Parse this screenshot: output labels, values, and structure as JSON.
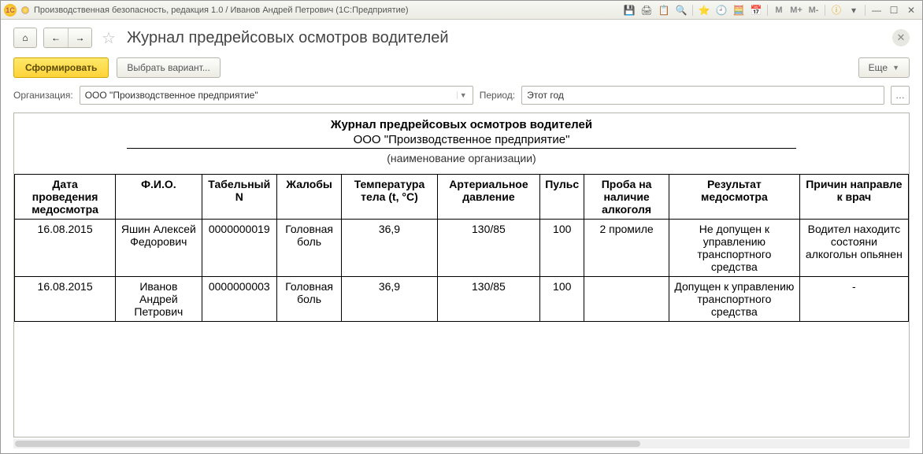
{
  "window": {
    "title": "Производственная безопасность, редакция 1.0 / Иванов Андрей Петрович  (1С:Предприятие)",
    "logo_text": "1C"
  },
  "titlebar_icons": {
    "save": "💾",
    "print": "🖨",
    "copy": "📋",
    "search": "🔍",
    "fav": "⭐",
    "history": "🕘",
    "calc": "🧮",
    "cal": "📅",
    "m": "M",
    "mplus": "M+",
    "mminus": "M-",
    "info": "ⓘ"
  },
  "win_controls": {
    "min": "—",
    "max": "☐",
    "close": "✕"
  },
  "page": {
    "title": "Журнал предрейсовых осмотров водителей"
  },
  "toolbar": {
    "form_btn": "Сформировать",
    "variant_btn": "Выбрать вариант...",
    "more_btn": "Еще"
  },
  "filters": {
    "org_label": "Организация:",
    "org_value": "ООО \"Производственное предприятие\"",
    "period_label": "Период:",
    "period_value": "Этот год"
  },
  "report_header": {
    "title": "Журнал предрейсовых осмотров водителей",
    "org": "ООО \"Производственное предприятие\"",
    "hint": "(наименование организации)"
  },
  "table": {
    "headers": [
      "Дата проведения медосмотра",
      "Ф.И.О.",
      "Табельный N",
      "Жалобы",
      "Температура тела (t, °C)",
      "Артериальное давление",
      "Пульс",
      "Проба на наличие алкоголя",
      "Результат медосмотра",
      "Причин направле к врач"
    ],
    "rows": [
      {
        "date": "16.08.2015",
        "fio": "Яшин Алексей Федорович",
        "tabn": "0000000019",
        "complaints": "Головная боль",
        "temp": "36,9",
        "bp": "130/85",
        "pulse": "100",
        "alcohol": "2 промиле",
        "result": "Не допущен к управлению транспортного средства",
        "reason": "Водител находитс состояни алкогольн опьянен"
      },
      {
        "date": "16.08.2015",
        "fio": "Иванов Андрей Петрович",
        "tabn": "0000000003",
        "complaints": "Головная боль",
        "temp": "36,9",
        "bp": "130/85",
        "pulse": "100",
        "alcohol": "",
        "result": "Допущен к управлению транспортного средства",
        "reason": "-"
      }
    ]
  }
}
